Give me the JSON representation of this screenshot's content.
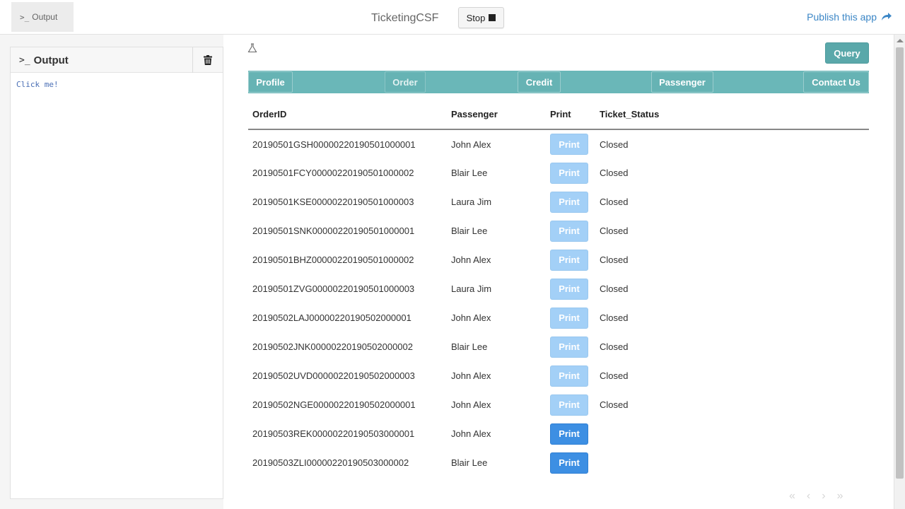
{
  "topbar": {
    "output_tab": "Output",
    "app_title": "TicketingCSF",
    "stop_label": "Stop",
    "publish_label": "Publish this app",
    "accent": "#3b86c6"
  },
  "output_panel": {
    "title": "Output",
    "console_text": "Click me!"
  },
  "main": {
    "query_label": "Query",
    "nav": [
      {
        "label": "Profile"
      },
      {
        "label": "Order"
      },
      {
        "label": "Credit"
      },
      {
        "label": "Passenger"
      },
      {
        "label": "Contact Us"
      }
    ],
    "table": {
      "headers": [
        "OrderID",
        "Passenger",
        "Print",
        "Ticket_Status"
      ],
      "print_label": "Print",
      "rows": [
        {
          "order_id": "20190501GSH00000220190501000001",
          "passenger": "John Alex",
          "print_enabled": false,
          "status": "Closed"
        },
        {
          "order_id": "20190501FCY00000220190501000002",
          "passenger": "Blair Lee",
          "print_enabled": false,
          "status": "Closed"
        },
        {
          "order_id": "20190501KSE00000220190501000003",
          "passenger": "Laura Jim",
          "print_enabled": false,
          "status": "Closed"
        },
        {
          "order_id": "20190501SNK00000220190501000001",
          "passenger": "Blair Lee",
          "print_enabled": false,
          "status": "Closed"
        },
        {
          "order_id": "20190501BHZ00000220190501000002",
          "passenger": "John Alex",
          "print_enabled": false,
          "status": "Closed"
        },
        {
          "order_id": "20190501ZVG00000220190501000003",
          "passenger": "Laura Jim",
          "print_enabled": false,
          "status": "Closed"
        },
        {
          "order_id": "20190502LAJ00000220190502000001",
          "passenger": "John Alex",
          "print_enabled": false,
          "status": "Closed"
        },
        {
          "order_id": "20190502JNK00000220190502000002",
          "passenger": "Blair Lee",
          "print_enabled": false,
          "status": "Closed"
        },
        {
          "order_id": "20190502UVD00000220190502000003",
          "passenger": "John Alex",
          "print_enabled": false,
          "status": "Closed"
        },
        {
          "order_id": "20190502NGE00000220190502000001",
          "passenger": "John Alex",
          "print_enabled": false,
          "status": "Closed"
        },
        {
          "order_id": "20190503REK00000220190503000001",
          "passenger": "John Alex",
          "print_enabled": true,
          "status": ""
        },
        {
          "order_id": "20190503ZLI00000220190503000002",
          "passenger": "Blair Lee",
          "print_enabled": true,
          "status": ""
        }
      ]
    },
    "pager": {
      "first": "«",
      "prev": "‹",
      "next": "›",
      "last": "»"
    }
  },
  "colors": {
    "teal": "#6ab7b8",
    "print_disabled": "#a3d0f7",
    "print_active": "#3d8fe3"
  }
}
